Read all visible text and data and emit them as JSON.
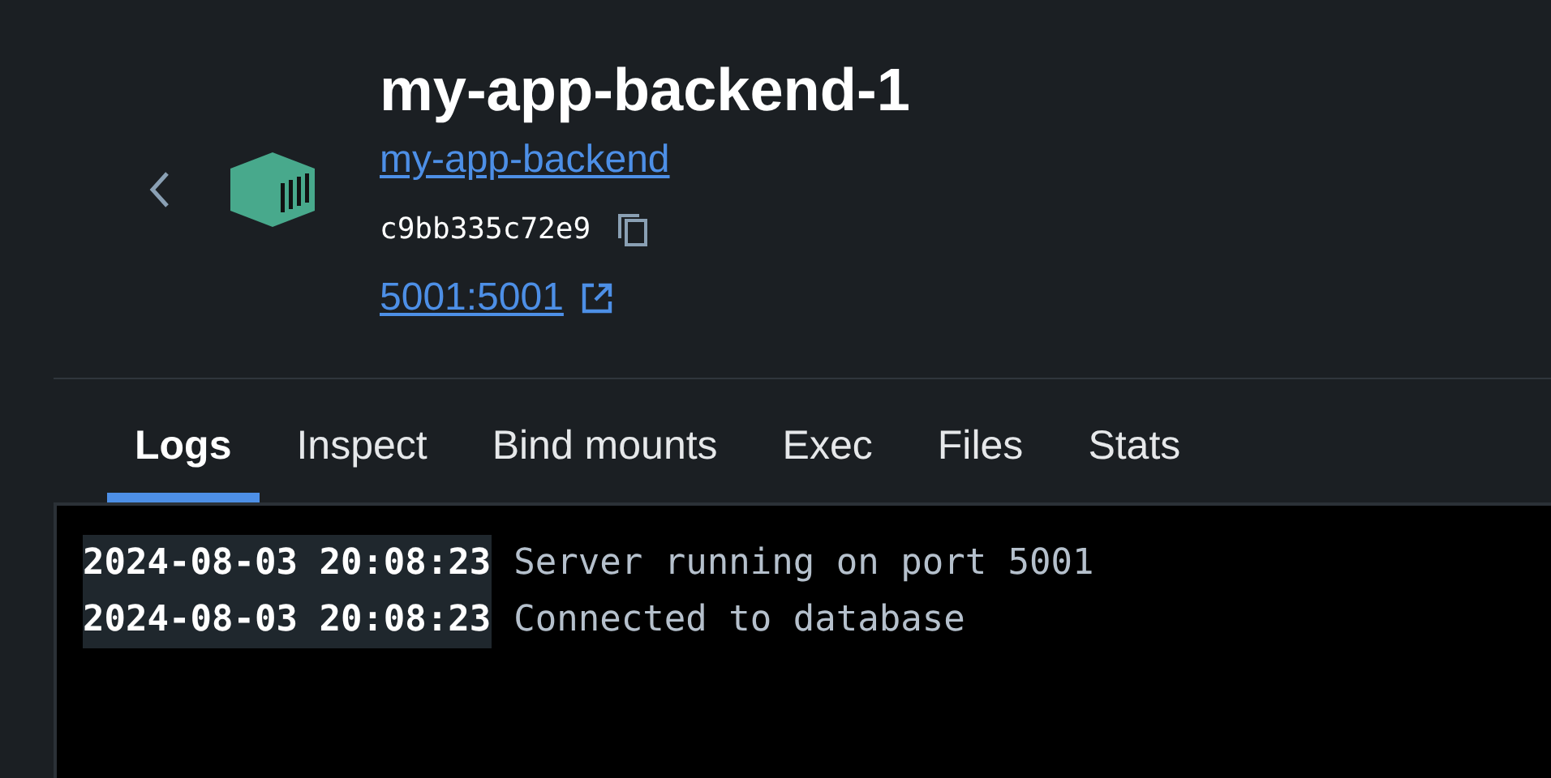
{
  "container": {
    "title": "my-app-backend-1",
    "image_link": "my-app-backend",
    "id": "c9bb335c72e9",
    "port_link": "5001:5001"
  },
  "tabs": [
    {
      "label": "Logs",
      "selected": true
    },
    {
      "label": "Inspect",
      "selected": false
    },
    {
      "label": "Bind mounts",
      "selected": false
    },
    {
      "label": "Exec",
      "selected": false
    },
    {
      "label": "Files",
      "selected": false
    },
    {
      "label": "Stats",
      "selected": false
    }
  ],
  "logs": [
    {
      "timestamp": "2024-08-03 20:08:23",
      "message": "Server running on port 5001"
    },
    {
      "timestamp": "2024-08-03 20:08:23",
      "message": "Connected to database"
    }
  ]
}
